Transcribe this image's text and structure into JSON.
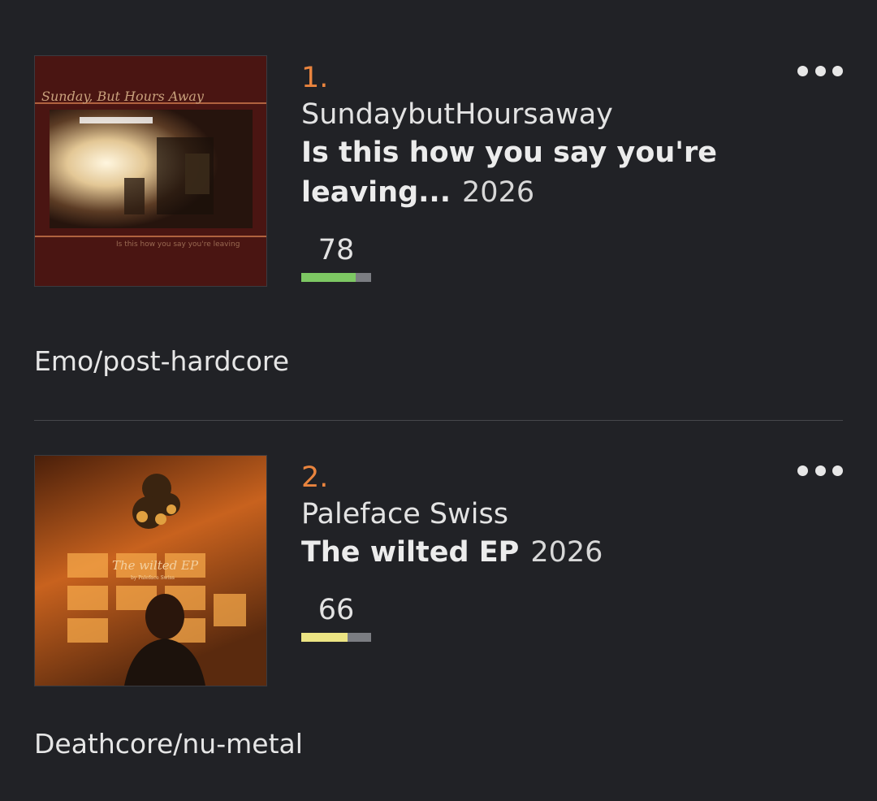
{
  "entries": [
    {
      "rank": "1.",
      "artist": "SundaybutHoursaway",
      "title": "Is this how you say you're leaving...",
      "title_line1": "Is this how you say you're",
      "title_line2": "leaving...",
      "year": "2026",
      "score": "78",
      "score_fraction": 0.78,
      "score_color": "#7dc863",
      "genre": "Emo/post-hardcore",
      "cover": {
        "band_text": "Sunday, But Hours Away",
        "subtitle_text": "Is this how you say you're leaving",
        "colors": {
          "background": "#4a1512",
          "photo_light": "#f5e6c6"
        }
      }
    },
    {
      "rank": "2.",
      "artist": "Paleface Swiss",
      "title": "The wilted EP",
      "year": "2026",
      "score": "66",
      "score_fraction": 0.66,
      "score_color": "#ece483",
      "genre": "Deathcore/nu-metal",
      "cover": {
        "title_text": "The wilted EP",
        "subtitle_text": "by Paleface Swiss",
        "colors": {
          "background": "#3a1c0c",
          "light": "#f2a040"
        }
      }
    }
  ],
  "more_icon": "more-horizontal-icon",
  "accent_color": "#e9843e"
}
